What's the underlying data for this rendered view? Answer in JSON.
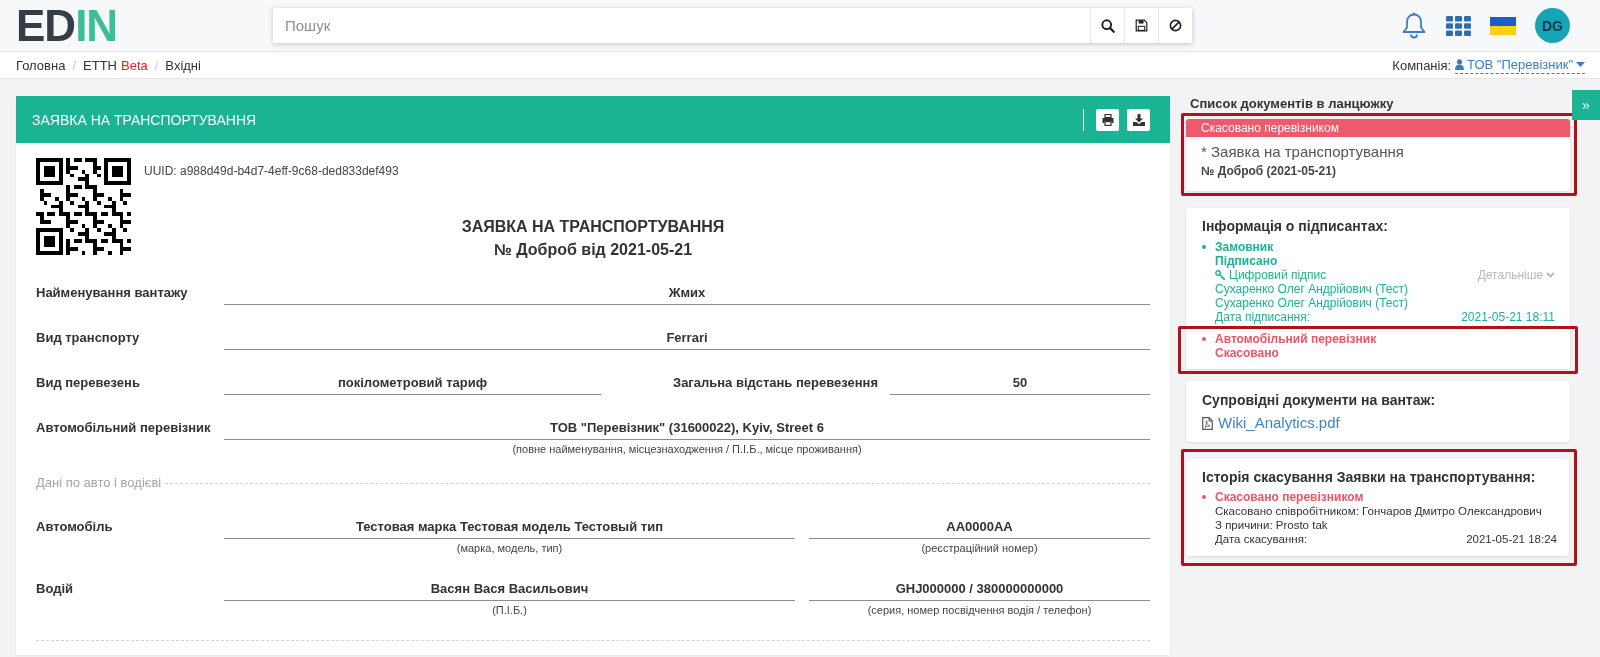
{
  "header": {
    "logo": {
      "dark": "ED",
      "accent": "IN"
    },
    "search": {
      "placeholder": "Пошук"
    },
    "avatar": "DG"
  },
  "breadcrumbs": {
    "separator": "/",
    "items": [
      {
        "label": "Головна"
      },
      {
        "label": "ЕТТН",
        "badge": "Beta"
      },
      {
        "label": "Вхідні"
      }
    ]
  },
  "company": {
    "label": "Компанія:",
    "name": "ТОВ \"Перевізник\""
  },
  "document": {
    "header_title": "ЗАЯВКА НА ТРАНСПОРТУВАННЯ",
    "uuid": "UUID: a988d49d-b4d7-4eff-9c68-ded833def493",
    "title": "ЗАЯВКА НА ТРАНСПОРТУВАННЯ",
    "number": "№ Доброб від 2021-05-21",
    "rows": [
      {
        "kind": "field",
        "label": "Найменування вантажу",
        "cells": [
          {
            "value": "Жмих"
          }
        ]
      },
      {
        "kind": "field",
        "label": "Вид транспорту",
        "cells": [
          {
            "value": "Ferrari"
          }
        ]
      },
      {
        "kind": "field",
        "label": "Вид перевезень",
        "cells": [
          {
            "value": "покілометровий тариф"
          },
          {
            "label": "Загальна відстань перевезення",
            "value": "50"
          }
        ]
      },
      {
        "kind": "field",
        "label": "Автомобільний перевізник",
        "cells": [
          {
            "value": "ТОВ \"Перевізник\" (31600022), Kyiv, Street 6",
            "hint": "(повне найменування, місцезнаходження / П.І.Б., місце проживання)"
          }
        ]
      },
      {
        "kind": "section",
        "label": "Дані по авто і водієві"
      },
      {
        "kind": "field",
        "label": "Автомобіль",
        "cells": [
          {
            "value": "Тестовая марка Тестовая модель Тестовый тип",
            "hint": "(марка, модель, тип)"
          },
          {
            "value": "AA0000AA",
            "hint": "(реєстраційний номер)"
          }
        ]
      },
      {
        "kind": "field",
        "label": "Водій",
        "cells": [
          {
            "value": "Васян Вася Васильович",
            "hint": "(П.І.Б.)"
          },
          {
            "value": "GHJ000000 / 380000000000",
            "hint": "(серия, номер посвідчення водія / телефон)"
          }
        ]
      }
    ]
  },
  "sidebar_toggle": "»",
  "chain": {
    "title": "Список документів в ланцюжку",
    "documents": [
      {
        "status": "Скасовано перевізником",
        "color": "#ec5a6b",
        "name": "* Заявка на транспортування",
        "number": "№ Доброб (2021-05-21)",
        "highlighted": true
      }
    ]
  },
  "signers": {
    "title": "Інформація о підписантах:",
    "items": [
      {
        "role": "Замовник",
        "status": "Підписано",
        "color": "#1ab394",
        "highlighted": false,
        "signature": {
          "label": "Цифровий підпис",
          "details": "Детальніше",
          "names": [
            "Сухаренко Олег Андрійович (Тест)",
            "Сухаренко Олег Андрійович (Тест)"
          ],
          "date_label": "Дата підписання:",
          "date": "2021-05-21 18:11"
        }
      },
      {
        "role": "Автомобільний перевізник",
        "status": "Скасовано",
        "color": "#ed5565",
        "highlighted": true
      }
    ]
  },
  "attachments": {
    "title": "Супровідні документи на вантаж:",
    "files": [
      "Wiki_Analytics.pdf"
    ]
  },
  "cancellation_history": {
    "title": "Історія скасування Заявки на транспортування:",
    "highlighted": true,
    "items": [
      {
        "status": "Скасовано перевізником",
        "color": "#ed5565",
        "lines": [
          "Скасовано співробітником: Гончаров Дмитро Олександрович",
          "З причини: Prosto tak"
        ],
        "date_label": "Дата скасування:",
        "date": "2021-05-21 18:24"
      }
    ]
  }
}
